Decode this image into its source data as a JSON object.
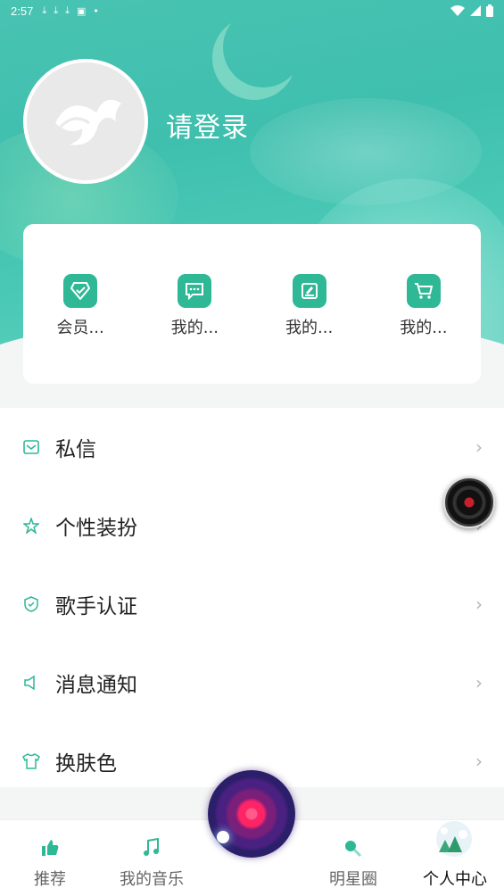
{
  "status_bar": {
    "time": "2:57",
    "left_icons": [
      "download-icon",
      "download-icon",
      "download-icon",
      "a-badge-icon",
      "dot-icon"
    ],
    "right_icons": [
      "wifi-icon",
      "signal-icon",
      "battery-icon"
    ]
  },
  "profile": {
    "login_text": "请登录",
    "avatar_icon": "squirrel-logo"
  },
  "quick_actions": [
    {
      "label": "会员...",
      "icon": "diamond-icon"
    },
    {
      "label": "我的...",
      "icon": "message-icon"
    },
    {
      "label": "我的...",
      "icon": "edit-icon"
    },
    {
      "label": "我的...",
      "icon": "cart-icon"
    }
  ],
  "menu": [
    {
      "label": "私信",
      "icon": "mail-icon"
    },
    {
      "label": "个性装扮",
      "icon": "star-icon"
    },
    {
      "label": "歌手认证",
      "icon": "shield-icon"
    },
    {
      "label": "消息通知",
      "icon": "speaker-icon"
    },
    {
      "label": "换肤色",
      "icon": "shirt-icon"
    }
  ],
  "tabbar": [
    {
      "label": "推荐",
      "icon": "thumbs-up-icon",
      "active": false
    },
    {
      "label": "我的音乐",
      "icon": "music-note-icon",
      "active": false
    },
    {
      "label": "明星圈",
      "icon": "search-icon",
      "active": false
    },
    {
      "label": "个人中心",
      "icon": "profile-badge-icon",
      "active": true
    }
  ],
  "colors": {
    "accent": "#2eb896",
    "hero": "#43c2b0"
  }
}
